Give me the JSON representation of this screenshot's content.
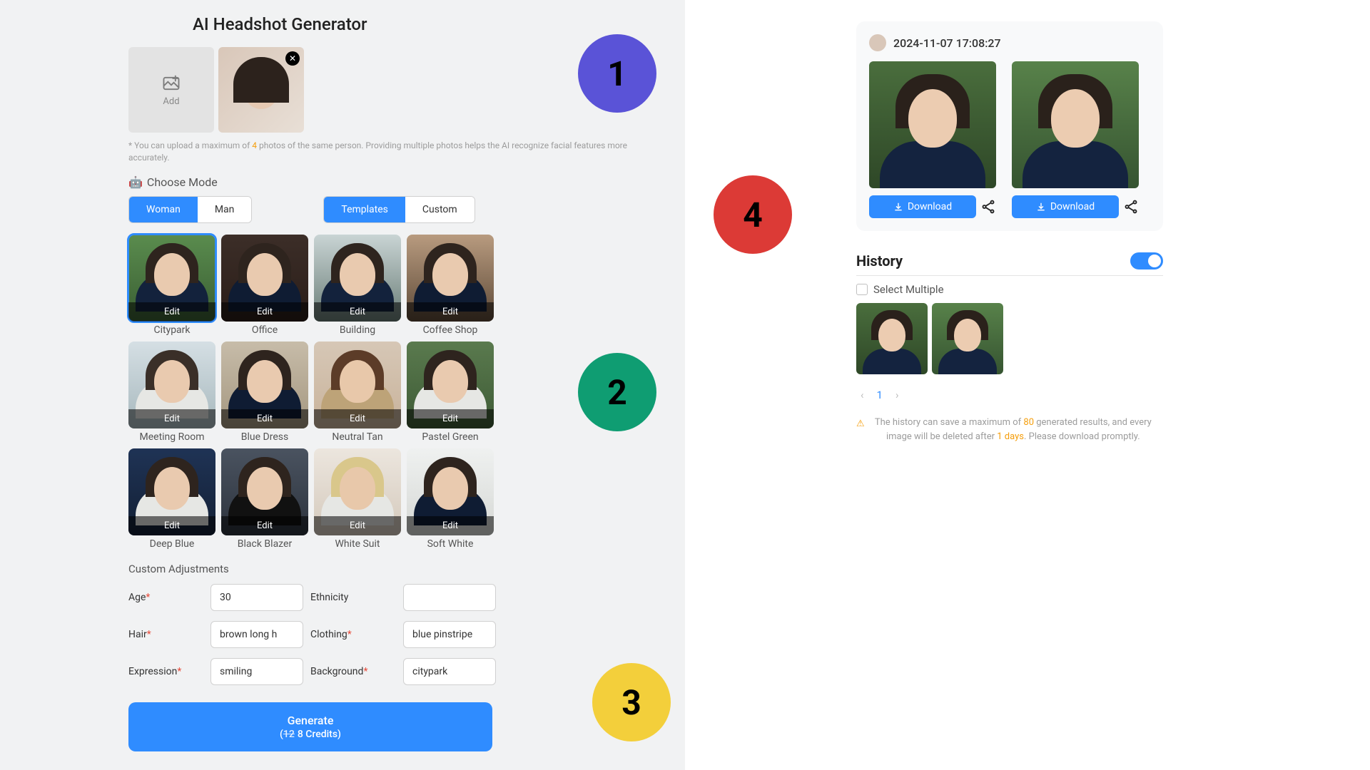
{
  "page": {
    "title": "AI Headshot Generator",
    "upload": {
      "add_label": "Add",
      "note_prefix": "* You can upload a maximum of ",
      "note_max": "4",
      "note_suffix": " photos of the same person. Providing multiple photos helps the AI recognize facial features more accurately."
    },
    "mode": {
      "label": "Choose Mode",
      "gender": {
        "woman": "Woman",
        "man": "Man",
        "selected": "woman"
      },
      "style": {
        "templates": "Templates",
        "custom": "Custom",
        "selected": "templates"
      }
    },
    "templates": {
      "edit_label": "Edit",
      "items": [
        {
          "name": "Citypark",
          "bg": "bg-citypark",
          "body": "navy",
          "selected": true
        },
        {
          "name": "Office",
          "bg": "bg-office",
          "body": "darknavy"
        },
        {
          "name": "Building",
          "bg": "bg-building",
          "body": "navy"
        },
        {
          "name": "Coffee Shop",
          "bg": "bg-coffee",
          "body": "darknavy"
        },
        {
          "name": "Meeting Room",
          "bg": "bg-meeting",
          "body": "white"
        },
        {
          "name": "Blue Dress",
          "bg": "bg-bluedress",
          "body": "darknavy"
        },
        {
          "name": "Neutral Tan",
          "bg": "bg-neutral",
          "body": "beige"
        },
        {
          "name": "Pastel Green",
          "bg": "bg-pastel",
          "body": "white"
        },
        {
          "name": "Deep Blue",
          "bg": "bg-deepblue",
          "body": "white"
        },
        {
          "name": "Black Blazer",
          "bg": "bg-black",
          "body": "black"
        },
        {
          "name": "White Suit",
          "bg": "bg-whitesuit",
          "body": "white"
        },
        {
          "name": "Soft White",
          "bg": "bg-softwhite",
          "body": "darknavy"
        }
      ]
    },
    "adjustments": {
      "title": "Custom Adjustments",
      "age": {
        "label": "Age",
        "value": "30"
      },
      "ethnicity": {
        "label": "Ethnicity",
        "value": ""
      },
      "hair": {
        "label": "Hair",
        "value": "brown long h"
      },
      "clothing": {
        "label": "Clothing",
        "value": "blue pinstripe"
      },
      "expression": {
        "label": "Expression",
        "value": "smiling"
      },
      "background": {
        "label": "Background",
        "value": "citypark"
      }
    },
    "generate": {
      "label": "Generate",
      "old_credits": "12",
      "new_credits": "8 Credits"
    }
  },
  "results": {
    "timestamp": "2024-11-07 17:08:27",
    "download_label": "Download"
  },
  "history": {
    "title": "History",
    "select_multiple": "Select Multiple",
    "page": "1",
    "note_prefix": "The history can save a maximum of ",
    "note_max": "80",
    "note_mid": " generated results, and every image will be deleted after ",
    "note_days": "1 days",
    "note_suffix": ". Please download promptly."
  },
  "badges": {
    "b1": "1",
    "b2": "2",
    "b3": "3",
    "b4": "4"
  }
}
